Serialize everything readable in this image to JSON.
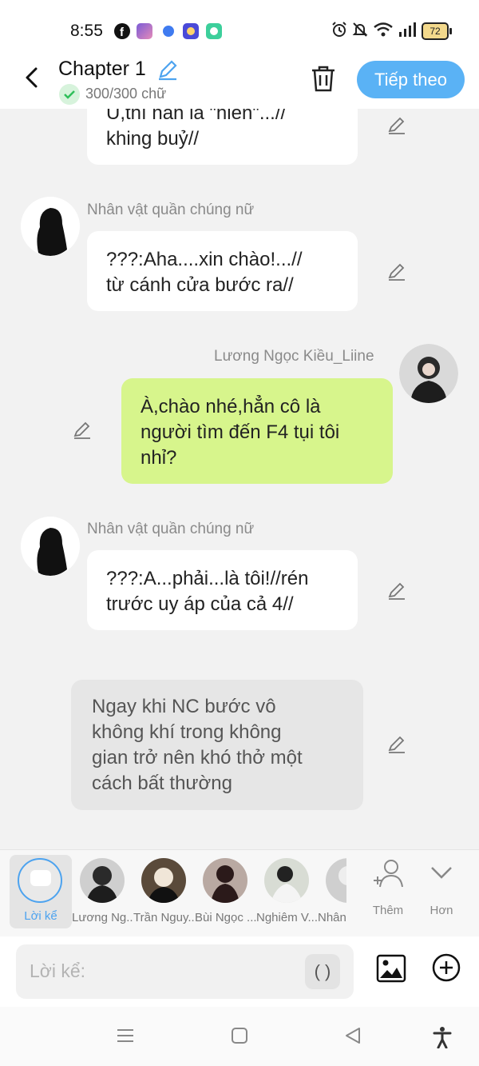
{
  "status": {
    "time": "8:55",
    "battery": "72"
  },
  "header": {
    "title": "Chapter 1",
    "word_count": "300/300 chữ",
    "next_label": "Tiếp theo"
  },
  "messages": [
    {
      "text_lines": [
        "U,thì hắn là \"hiền\"...//",
        "khing buỷ//"
      ]
    },
    {
      "name": "Nhân vật quần chúng nữ",
      "text_lines": [
        "???:Aha....xin chào!...//",
        "từ cánh cửa bước ra//"
      ]
    },
    {
      "name": "Lương Ngọc Kiều_Liine",
      "text_lines": [
        "À,chào nhé,hẳn cô là",
        "người tìm đến F4 tụi tôi",
        "nhỉ?"
      ]
    },
    {
      "name": "Nhân vật quần chúng nữ",
      "text_lines": [
        "???:A...phải...là tôi!//rén",
        "trước uy áp của cả 4//"
      ]
    },
    {
      "text_lines": [
        "Ngay khi NC bước vô",
        "không khí trong không",
        "gian trở nên khó thở một",
        "cách bất thường"
      ]
    }
  ],
  "cast_bar": {
    "narrator_label": "Lời kể",
    "characters": [
      "Lương Ng...",
      "Trần Nguy...",
      "Bùi Ngọc ...",
      "Nghiêm V...",
      "Nhân"
    ],
    "add_label": "Thêm",
    "more_label": "Hơn"
  },
  "input": {
    "placeholder": "Lời kể:",
    "paren": "( )"
  },
  "colors": {
    "accent": "#5ab2f5",
    "me_bubble": "#d7f58c",
    "narration_bubble": "#e6e6e6"
  }
}
